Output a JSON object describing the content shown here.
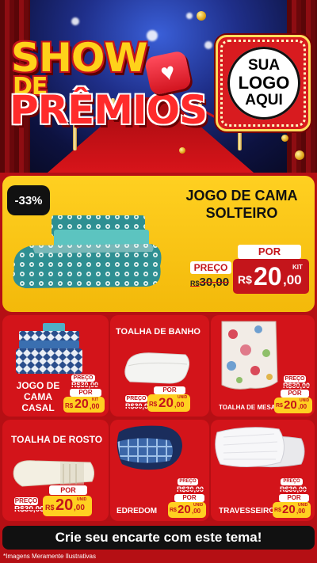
{
  "hero": {
    "title_line1": "SHOW",
    "title_line2": "DE",
    "title_line3": "PRÊMIOS",
    "logo_line1": "SUA",
    "logo_line2": "LOGO",
    "logo_line3": "AQUI"
  },
  "featured": {
    "discount": "-33%",
    "title_line1": "JOGO DE CAMA",
    "title_line2": "SOLTEIRO",
    "preco_label": "PREÇO",
    "por_label": "POR",
    "old_currency": "R$",
    "old_value": "30,00",
    "new_currency": "R$",
    "new_int": "20",
    "new_dec": ",00",
    "unit": "KIT"
  },
  "products": [
    {
      "title_lines": [
        "JOGO DE",
        "CAMA",
        "CASAL"
      ],
      "preco_label": "PREÇO",
      "por_label": "POR",
      "old": "R$30,00",
      "new_currency": "R$",
      "new_int": "20",
      "new_dec": ",00",
      "unit": "KIT"
    },
    {
      "title_lines": [
        "TOALHA DE BANHO"
      ],
      "preco_label": "PREÇO",
      "por_label": "POR",
      "old": "R$30,00",
      "new_currency": "R$",
      "new_int": "20",
      "new_dec": ",00",
      "unit": "UNID"
    },
    {
      "title_lines": [
        "TOALHA DE MESA"
      ],
      "preco_label": "PREÇO",
      "por_label": "POR",
      "old": "R$30,00",
      "new_currency": "R$",
      "new_int": "20",
      "new_dec": ",00",
      "unit": "UNID"
    },
    {
      "title_lines": [
        "TOALHA DE ROSTO"
      ],
      "preco_label": "PREÇO",
      "por_label": "POR",
      "old": "R$30,00",
      "new_currency": "R$",
      "new_int": "20",
      "new_dec": ",00",
      "unit": "UNID"
    },
    {
      "title_lines": [
        "EDREDOM"
      ],
      "preco_label": "PREÇO",
      "por_label": "POR",
      "old": "R$30,00",
      "new_currency": "R$",
      "new_int": "20",
      "new_dec": ",00",
      "unit": "UNID"
    },
    {
      "title_lines": [
        "TRAVESSEIRO"
      ],
      "preco_label": "PREÇO",
      "por_label": "POR",
      "old": "R$30,00",
      "new_currency": "R$",
      "new_int": "20",
      "new_dec": ",00",
      "unit": "UNID"
    }
  ],
  "cta": "Crie seu encarte com este tema!",
  "disclaimer": "*Imagens Meramente Ilustrativas",
  "colors": {
    "brand_red": "#c4151b",
    "card_red": "#d3141a",
    "featured_yellow": "#ffd021",
    "black": "#111111"
  },
  "icons": [
    "heart-icon"
  ]
}
